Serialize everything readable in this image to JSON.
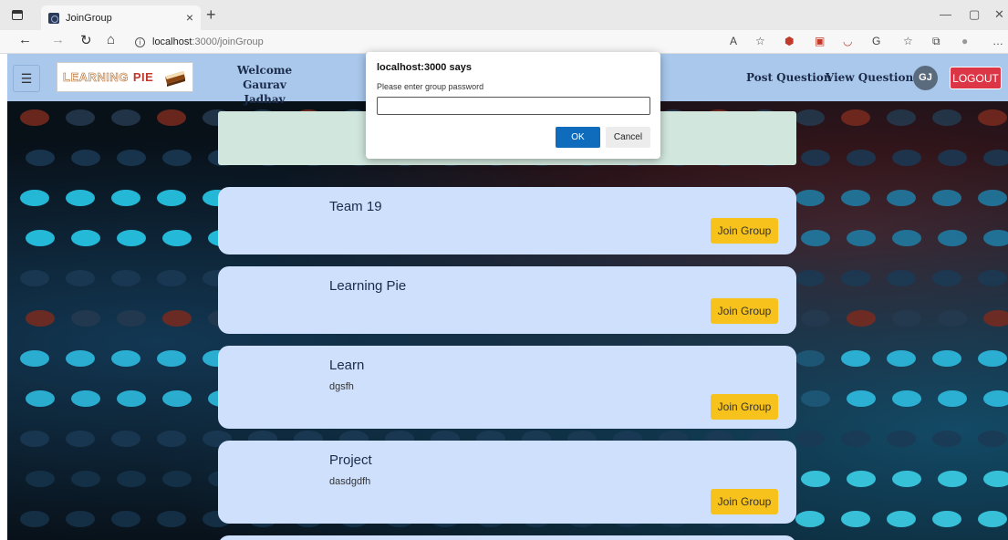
{
  "browser": {
    "tab_title": "JoinGroup",
    "url_host": "localhost",
    "url_path": ":3000/joinGroup"
  },
  "navbar": {
    "logo_text_1": "LEARNING",
    "logo_text_2": "PIE",
    "welcome_line1": "Welcome",
    "welcome_line2": "Gaurav Jadhav",
    "post_question": "Post Question",
    "view_questions": "View Questions",
    "avatar_initials": "GJ",
    "logout": "LOGOUT"
  },
  "groups": [
    {
      "title": "Team 19",
      "description": "",
      "button": "Join Group"
    },
    {
      "title": "Learning Pie",
      "description": "",
      "button": "Join Group"
    },
    {
      "title": "Learn",
      "description": "dgsfh",
      "button": "Join Group"
    },
    {
      "title": "Project",
      "description": "dasdgdfh",
      "button": "Join Group"
    }
  ],
  "dialog": {
    "title": "localhost:3000 says",
    "message": "Please enter group password",
    "input_value": "",
    "ok": "OK",
    "cancel": "Cancel"
  },
  "colors": {
    "navbar": "#a9c8ec",
    "card": "#cfe0fc",
    "join_button": "#f7c21b",
    "logout": "#dc3545",
    "dialog_ok": "#0f6cbd"
  }
}
